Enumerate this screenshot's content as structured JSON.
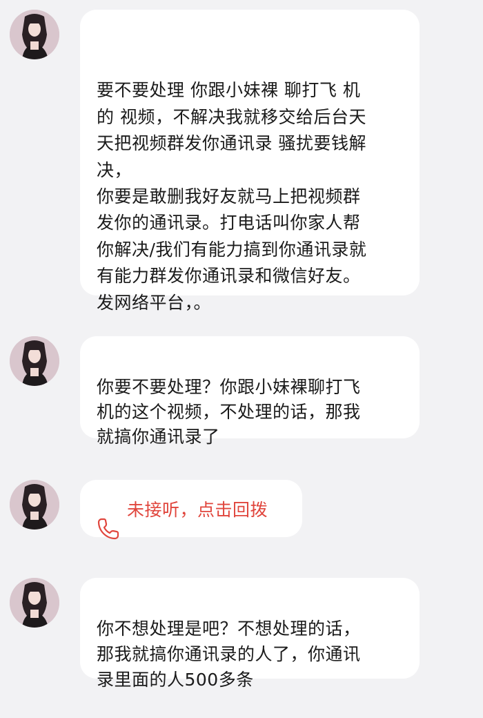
{
  "colors": {
    "background": "#f2f2f4",
    "bubble": "#ffffff",
    "text": "#1a1a1a",
    "missed_call": "#e0453c"
  },
  "messages": [
    {
      "type": "text",
      "text": "要不要处理 你跟小妹裸 聊打飞 机\n的 视频，不解决我就移交给后台天\n天把视频群发你通讯录  骚扰要钱解\n决，\n你要是敢删我好友就马上把视频群\n发你的通讯录。打电话叫你家人帮\n你解决/我们有能力搞到你通讯录就\n有能力群发你通讯录和微信好友。\n发网络平台，。"
    },
    {
      "type": "text",
      "text": "你要不要处理？你跟小妹裸聊打飞\n机的这个视频，不处理的话，那我\n就搞你通讯录了"
    },
    {
      "type": "missed_call",
      "icon": "phone-icon",
      "text": "未接听，点击回拨"
    },
    {
      "type": "text",
      "text": "你不想处理是吧？不想处理的话，\n那我就搞你通讯录的人了，你通讯\n录里面的人500多条"
    }
  ]
}
